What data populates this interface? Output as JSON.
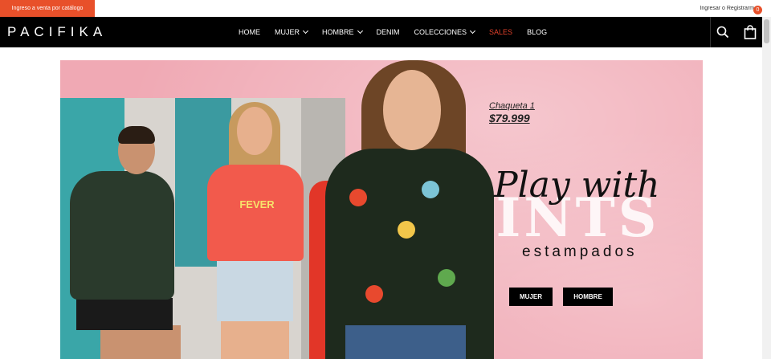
{
  "topbar": {
    "promo_label": "Ingreso a venta por catálogo",
    "login_label": "Ingresar",
    "separator": " o ",
    "register_label": "Registrarme"
  },
  "header": {
    "logo": "PACIFIKA",
    "nav": [
      {
        "label": "HOME",
        "has_dropdown": false
      },
      {
        "label": "MUJER",
        "has_dropdown": true
      },
      {
        "label": "HOMBRE",
        "has_dropdown": true
      },
      {
        "label": "DENIM",
        "has_dropdown": false
      },
      {
        "label": "COLECCIONES",
        "has_dropdown": true
      },
      {
        "label": "SALES",
        "has_dropdown": false
      },
      {
        "label": "BLOG",
        "has_dropdown": false
      }
    ],
    "cart_count": "0",
    "icons": {
      "search": "search-icon",
      "cart": "shopping-bag-icon"
    }
  },
  "banner": {
    "product_name": "Chaqueta 1",
    "product_price": "$79.999",
    "headline_script": "Play with",
    "headline_block": "PRINTS",
    "subheadline": "estampados",
    "buttons": {
      "mujer": "MUJER",
      "hombre": "HOMBRE"
    },
    "tee_print": "FEVER"
  },
  "colors": {
    "accent": "#e8502a",
    "header_bg": "#000000",
    "banner_bg": "#f0a9b4",
    "sales": "#e0402a"
  }
}
